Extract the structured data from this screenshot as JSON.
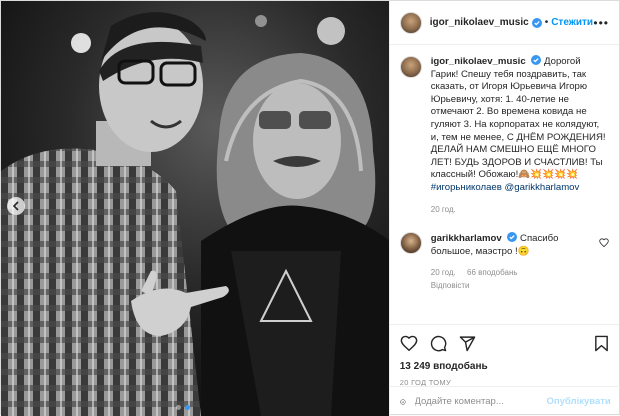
{
  "post": {
    "author": "igor_nikolaev_music",
    "follow_label": "Стежити",
    "caption_author": "igor_nikolaev_music",
    "caption_text": "Дорогой Гарик! Спешу тебя поздравить, так сказать, от Игоря Юрьевича Игорю Юрьевичу, хотя: 1. 40-летие не отмечают 2. Во времена ковида не гуляют 3. На корпоратах не колядуют, и, тем не менее, С ДНЁМ РОЖДЕНИЯ! ДЕЛАЙ НАМ СМЕШНО ЕЩЁ МНОГО ЛЕТ! БУДЬ ЗДОРОВ И СЧАСТЛИВ! Ты классный! Обожаю!🙈💥💥💥💥",
    "caption_hashtag": "#игорьниколаев",
    "caption_mention": "@garikkharlamov",
    "caption_age": "20 год.",
    "reply": {
      "author": "garikkharlamov",
      "text": "Спасибо большое, маэстро !🙃",
      "age": "20 год.",
      "likes": "66 вподобань",
      "reply_label": "Відповісти"
    },
    "likes": "13 249 вподобань",
    "timestamp": "20 ГОД ТОМУ",
    "comment_placeholder": "Додайте коментар...",
    "post_button": "Опублікувати"
  },
  "colors": {
    "accent": "#0095f6",
    "verified": "#3897f0",
    "text": "#262626",
    "muted": "#8e8e8e",
    "post_disabled": "#b2dffc"
  },
  "icons": [
    "more-icon",
    "verified-icon",
    "heart-icon",
    "comment-icon",
    "share-icon",
    "bookmark-icon",
    "emoji-icon",
    "chevron-left-icon"
  ]
}
